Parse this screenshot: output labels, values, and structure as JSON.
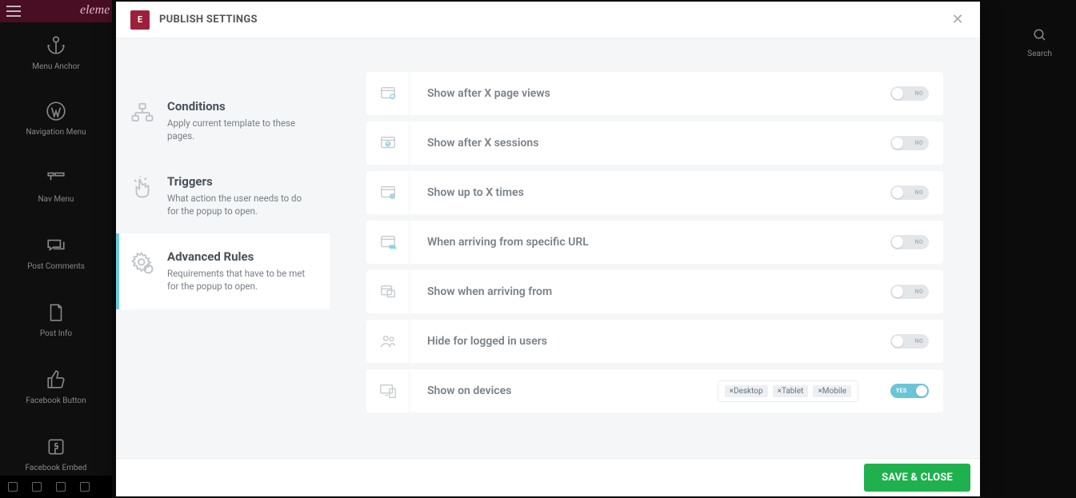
{
  "background": {
    "logo_text": "eleme",
    "widgets": [
      {
        "label": "Menu Anchor"
      },
      {
        "label": "Navigation Menu"
      },
      {
        "label": "Nav Menu"
      },
      {
        "label": "Post Comments"
      },
      {
        "label": "Post Info"
      },
      {
        "label": "Facebook Button"
      },
      {
        "label": "Facebook Embed"
      }
    ],
    "search_label": "Search"
  },
  "modal": {
    "title": "PUBLISH SETTINGS",
    "close_glyph": "✕",
    "tabs": [
      {
        "title": "Conditions",
        "desc": "Apply current template to these pages."
      },
      {
        "title": "Triggers",
        "desc": "What action the user needs to do for the popup to open."
      },
      {
        "title": "Advanced Rules",
        "desc": "Requirements that have to be met for the popup to open."
      }
    ],
    "rules": [
      {
        "label": "Show after X page views",
        "state": "NO"
      },
      {
        "label": "Show after X sessions",
        "state": "NO"
      },
      {
        "label": "Show up to X times",
        "state": "NO"
      },
      {
        "label": "When arriving from specific URL",
        "state": "NO"
      },
      {
        "label": "Show when arriving from",
        "state": "NO"
      },
      {
        "label": "Hide for logged in users",
        "state": "NO"
      },
      {
        "label": "Show on devices",
        "state": "YES",
        "tags": [
          "Desktop",
          "Tablet",
          "Mobile"
        ]
      }
    ],
    "save_label": "SAVE & CLOSE"
  }
}
